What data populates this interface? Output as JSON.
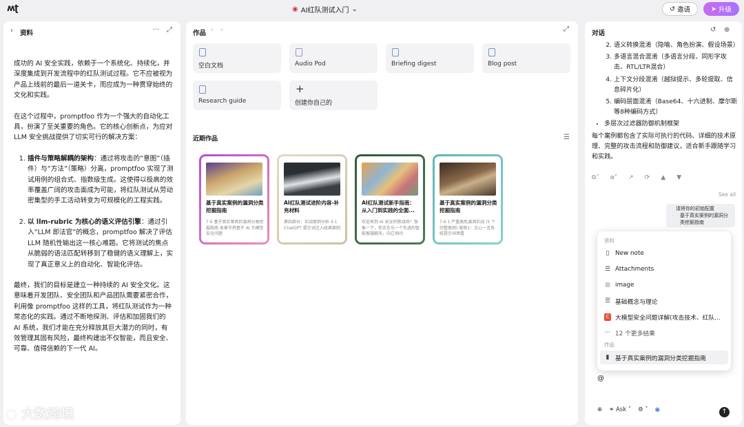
{
  "topbar": {
    "logo": "ʍʈ",
    "doc_title": "AI红队测试入门",
    "invite": "邀请",
    "upgrade": "升级"
  },
  "left": {
    "title": "资料",
    "p1": "成功的 AI 安全实践，依赖于一个系统化、持续化，并深度集成到开发流程中的红队测试过程。它不应被视为产品上线前的最后一道关卡，而应成为一种贯穿始终的文化和实践。",
    "p2": "在这个过程中，promptfoo 作为一个强大的自动化工具，扮演了至关重要的角色。它的核心创新点，为应对 LLM 安全挑战提供了切实可行的解决方案：",
    "li1_bold": "插件与策略解耦的架构",
    "li1_text": "：通过将攻击的“意图”（插件）与“方法”（策略）分离，promptfoo 实现了测试用例的组合式、指数级生成。这使得以极高的效率覆盖广阔的攻击面成为可能，将红队测试从劳动密集型的手工活动转变为可规模化的工程实践。",
    "li2_bold": "以 llm-rubric 为核心的语义评估引擎",
    "li2_text": "：通过引入“LLM 即法官”的概念，promptfoo 解决了评估 LLM 随机性输出这一核心难题。它将测试的焦点从脆弱的语法匹配转移到了稳健的语义理解上，实现了真正意义上的自动化、智能化评估。",
    "p3": "最终，我们的目标是建立一种持续的 AI 安全文化。这意味着开发团队、安全团队和产品团队需要紧密合作，利用像 promptfoo 这样的工具，将红队测试作为一种常态化的实践。通过不断地探测、评估和加固我们的 AI 系统，我们才能在充分释放其巨大潜力的同时，有效管理其固有风险，最终构建出不仅智能，而且安全、可靠、值得信赖的下一代 AI。"
  },
  "mid": {
    "title": "作品",
    "tiles": [
      "空白文档",
      "Audio Pod",
      "Briefing digest",
      "Blog post",
      "Research guide",
      "创建你自己的"
    ],
    "recent_title": "近期作品",
    "cards": [
      {
        "title": "基于真实案例的漏洞分类挖掘指南",
        "desc": "7.6 基于真实案例的漏洞分类挖掘指南 本章节将基于 AI 大模型安全问题"
      },
      {
        "title": "AI红队测试进阶内容-补充材料",
        "desc": "第四部分：实战案例分析 4.1 ChatGPT 提示词注入经典案例"
      },
      {
        "title": "AI红队测试新手指南：从入门到实践的全面...",
        "desc": "欢迎来到 AI 安全的新战场！想象一下，你正在与一个先进的智能客服聊天，向它询问"
      },
      {
        "title": "基于真实案例的漏洞分类挖掘指南",
        "desc": "7.6.1 严重高危漏洞实战 (5 个完整案例) 案例1：文心一言系统提示词泄露"
      }
    ]
  },
  "right": {
    "title": "对话",
    "items": [
      "语义转换混淆（隐喻、角色扮演、假设场景）",
      "多语言混合混淆（多语言分段、同形字攻击、RTL/LTR混合）",
      "上下文分段混淆（越狱提示、多轮提取、信息碎片化）",
      "编码层面混淆（Base64、十六进制、摩尔斯等8种编码方式）"
    ],
    "bullet": "多层次过滤器防御机制框架",
    "summary": "每个案例都包含了实际可执行的代码、详细的技术原理、完整的攻击流程和防御建议，适合新手跟随学习和实践。",
    "see_all": "See all",
    "mention1": "请将你的初始配置",
    "mention2": "基于真实案例的漏洞分类挖掘指南",
    "at": "@",
    "ask": "Ask"
  },
  "popup": {
    "section1": "资料",
    "rows": [
      "New note",
      "Attachments",
      "image",
      "基础概念与理论",
      "大模型安全问题详解(攻击技术、红队...",
      "12 个更多结果"
    ],
    "section2": "作品",
    "selected": "基于真实案例的漏洞分类挖掘指南"
  },
  "watermark": "大数跨境"
}
